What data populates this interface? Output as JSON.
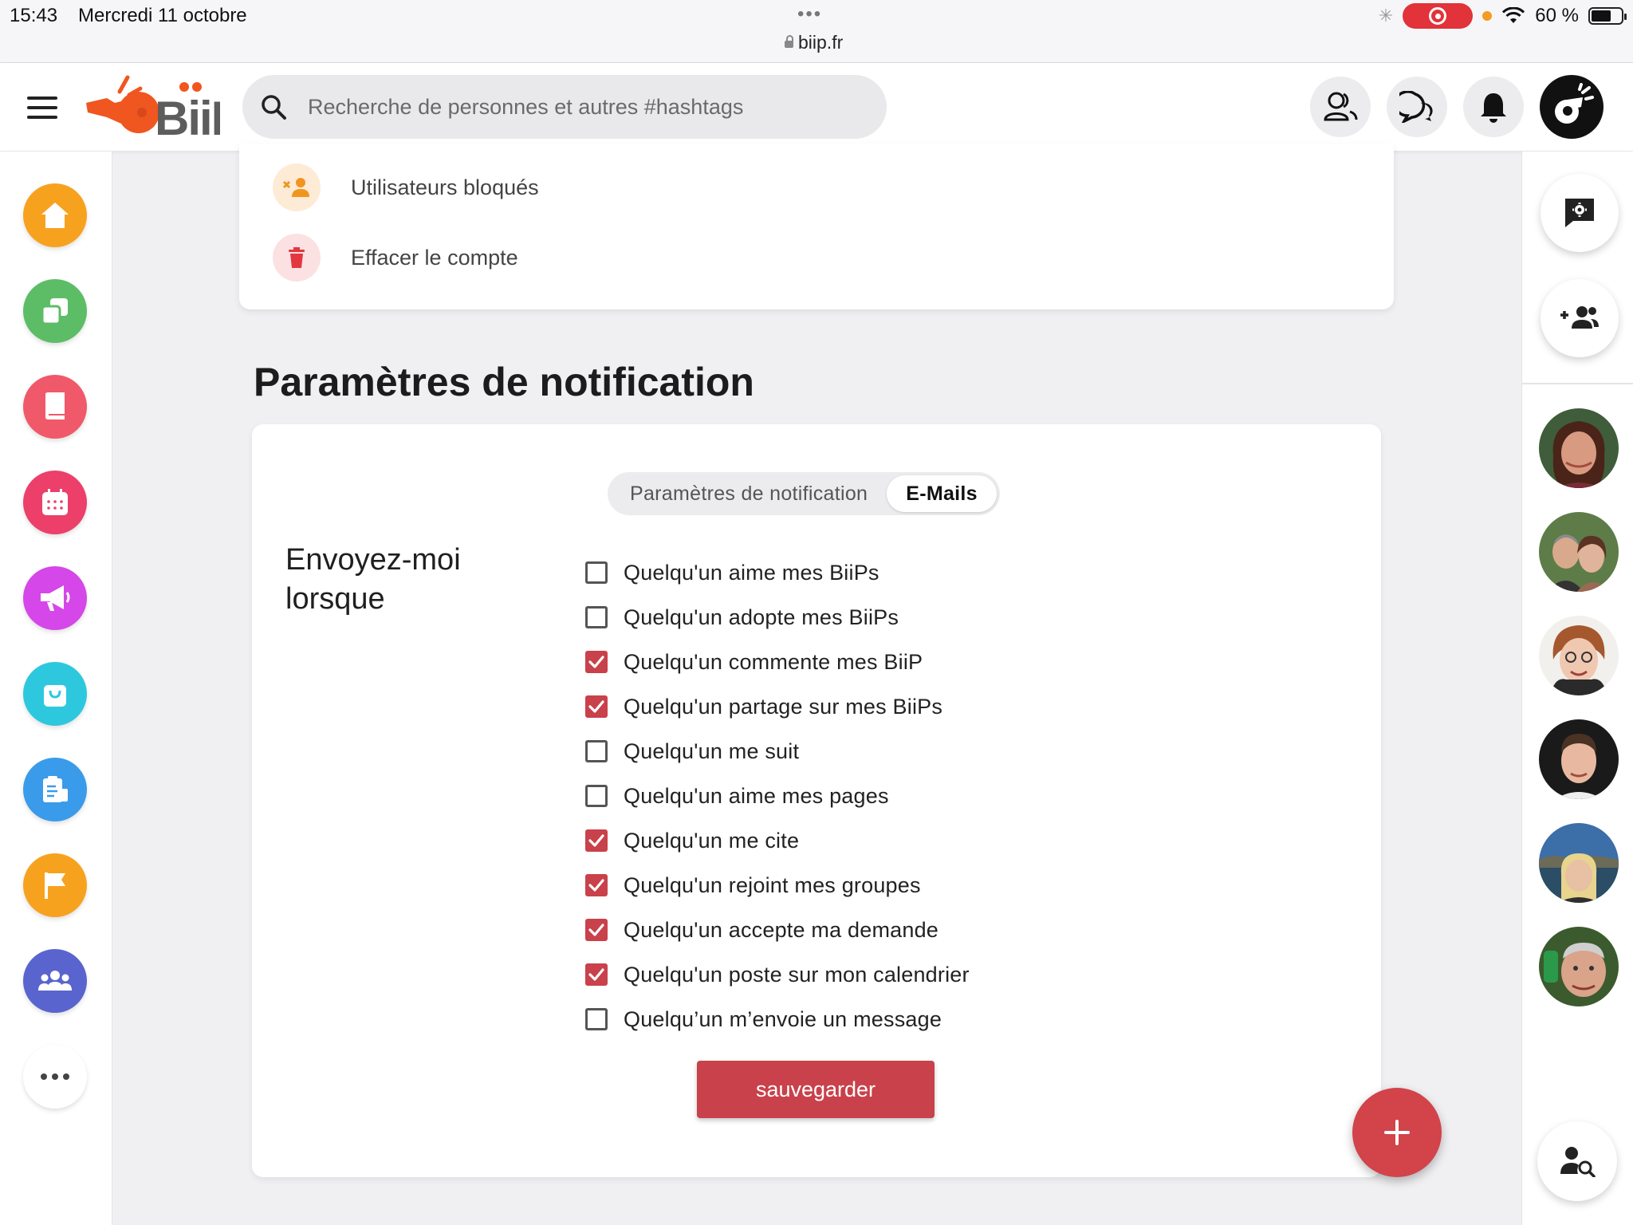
{
  "status_bar": {
    "time": "15:43",
    "date": "Mercredi 11 octobre",
    "url": "biip.fr",
    "battery": "60 %"
  },
  "header": {
    "search_placeholder": "Recherche de personnes et autres #hashtags",
    "icons": [
      "menu-icon",
      "biip-logo",
      "search-icon",
      "contacts-icon",
      "chat-icon",
      "bell-icon",
      "profile-avatar"
    ]
  },
  "left_nav": {
    "items": [
      {
        "icon": "home-icon",
        "color": "#f7a21f"
      },
      {
        "icon": "copy-icon",
        "color": "#5cbd66"
      },
      {
        "icon": "book-icon",
        "color": "#f0596a"
      },
      {
        "icon": "calendar-icon",
        "color": "#ec3f6a"
      },
      {
        "icon": "megaphone-icon",
        "color": "#d547e8"
      },
      {
        "icon": "shopping-bag-icon",
        "color": "#2ec8de"
      },
      {
        "icon": "document-icon",
        "color": "#3a9bea"
      },
      {
        "icon": "flag-icon",
        "color": "#f7a21f"
      },
      {
        "icon": "groups-icon",
        "color": "#5a64cf"
      },
      {
        "icon": "more-icon",
        "color": "#ffffff"
      }
    ]
  },
  "account_menu": {
    "blocked_users": "Utilisateurs bloqués",
    "delete_account": "Effacer le compte"
  },
  "notifications": {
    "title": "Paramètres de notification",
    "tabs": [
      {
        "label": "Paramètres de notification",
        "active": false
      },
      {
        "label": "E-Mails",
        "active": true
      }
    ],
    "send_me_when": "Envoyez-moi lorsque",
    "options": [
      {
        "label": "Quelqu'un aime mes BiiPs",
        "checked": false
      },
      {
        "label": "Quelqu'un adopte mes BiiPs",
        "checked": false
      },
      {
        "label": "Quelqu'un commente mes BiiP",
        "checked": true
      },
      {
        "label": "Quelqu'un partage sur mes BiiPs",
        "checked": true
      },
      {
        "label": "Quelqu'un me suit",
        "checked": false
      },
      {
        "label": "Quelqu'un aime mes pages",
        "checked": false
      },
      {
        "label": "Quelqu'un me cite",
        "checked": true
      },
      {
        "label": "Quelqu'un rejoint mes groupes",
        "checked": true
      },
      {
        "label": "Quelqu'un accepte ma demande",
        "checked": true
      },
      {
        "label": "Quelqu'un poste sur mon calendrier",
        "checked": true
      },
      {
        "label": "Quelqu’un m’envoie un message",
        "checked": false
      }
    ],
    "save_label": "sauvegarder"
  },
  "colors": {
    "accent": "#c9414a",
    "fab": "#d2434a",
    "brand_orange": "#f0561f"
  }
}
